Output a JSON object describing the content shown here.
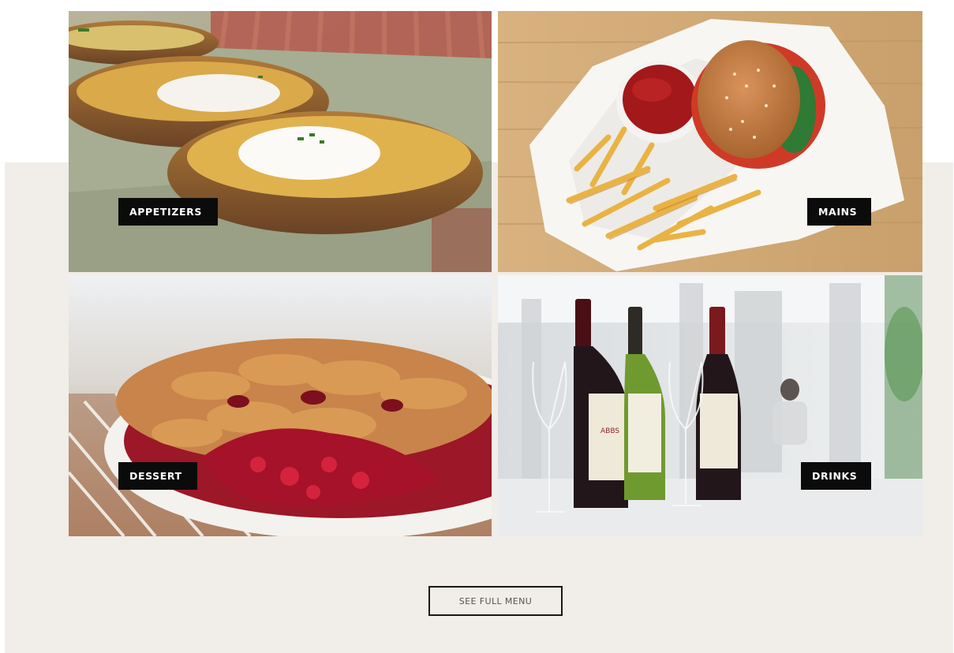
{
  "categories": {
    "appetizers": {
      "label": "APPETIZERS",
      "image": "potato-skins-photo"
    },
    "mains": {
      "label": "MAINS",
      "image": "burger-and-fries-photo"
    },
    "dessert": {
      "label": "DESSERT",
      "image": "cherry-pie-photo"
    },
    "drinks": {
      "label": "DRINKS",
      "image": "wine-bottles-photo"
    }
  },
  "cta": {
    "label": "SEE FULL MENU"
  },
  "colors": {
    "band_background": "#f1ede8",
    "label_background": "#0b0b0b",
    "label_text": "#ffffff",
    "button_border": "#1a1a1a"
  }
}
